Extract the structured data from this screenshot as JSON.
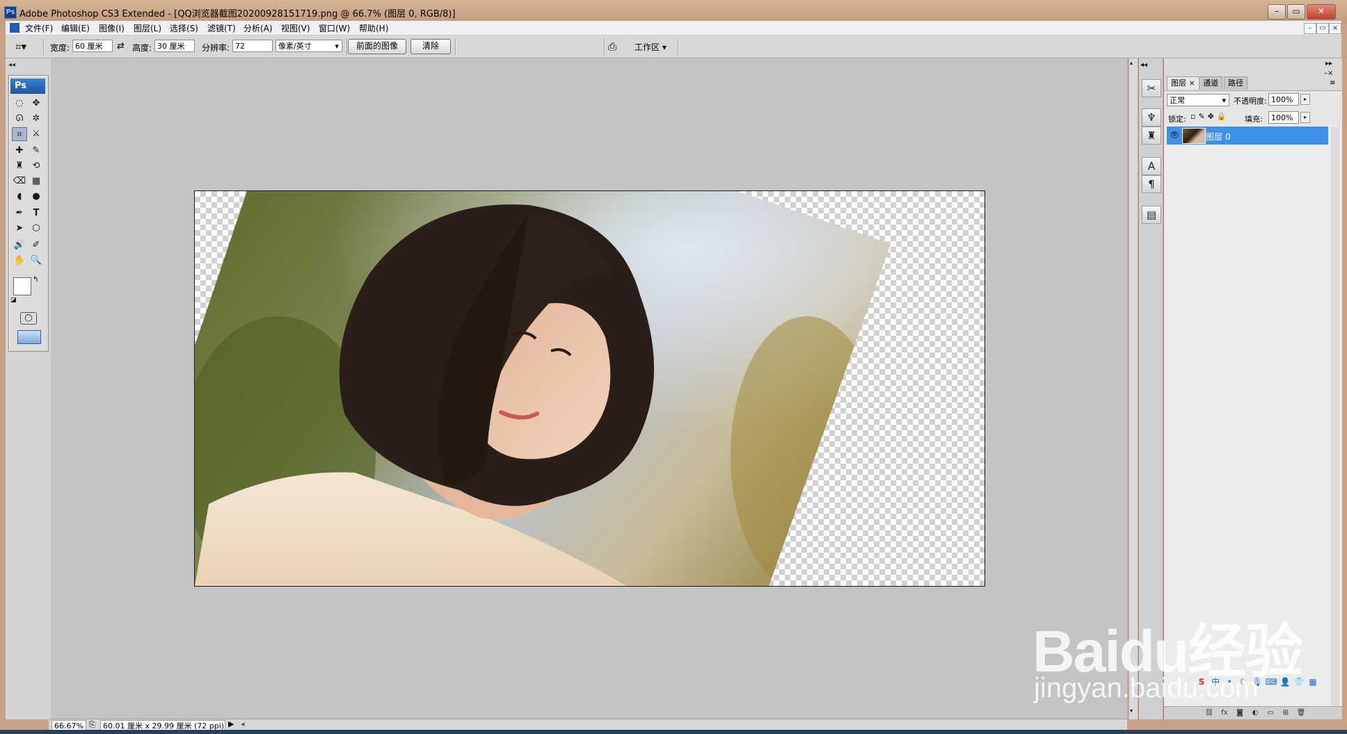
{
  "window": {
    "title": "Adobe Photoshop CS3 Extended - [QQ浏览器截图20200928151719.png @ 66.7% (图层 0, RGB/8)]",
    "minimize": "–",
    "restore": "▭",
    "close": "✕"
  },
  "menu": {
    "items": [
      "文件(F)",
      "编辑(E)",
      "图像(I)",
      "图层(L)",
      "选择(S)",
      "滤镜(T)",
      "分析(A)",
      "视图(V)",
      "窗口(W)",
      "帮助(H)"
    ]
  },
  "options_bar": {
    "width_label": "宽度:",
    "width_value": "60 厘米",
    "height_label": "高度:",
    "height_value": "30 厘米",
    "resolution_label": "分辨率:",
    "resolution_value": "72",
    "unit_value": "像素/英寸",
    "front_image_button": "前面的图像",
    "clear_button": "清除",
    "workspace_button": "工作区 ▾"
  },
  "toolbox": {
    "logo": "Ps"
  },
  "status": {
    "zoom": "66.67%",
    "doc_info": "60.01 厘米 x 29.99 厘米 (72 ppi)"
  },
  "layers_panel": {
    "tabs": [
      "图层 ×",
      "通道",
      "路径"
    ],
    "blend_mode": "正常",
    "opacity_label": "不透明度:",
    "opacity_value": "100%",
    "lock_label": "锁定:",
    "fill_label": "填充:",
    "fill_value": "100%",
    "layers": [
      {
        "name": "图层 0",
        "selected": true
      }
    ]
  },
  "watermark": {
    "logo": "Baidu经验",
    "url": "jingyan.baidu.com"
  },
  "colors": {
    "accent_selection": "#3d92e8",
    "workspace_bg": "#c3c3c3"
  }
}
